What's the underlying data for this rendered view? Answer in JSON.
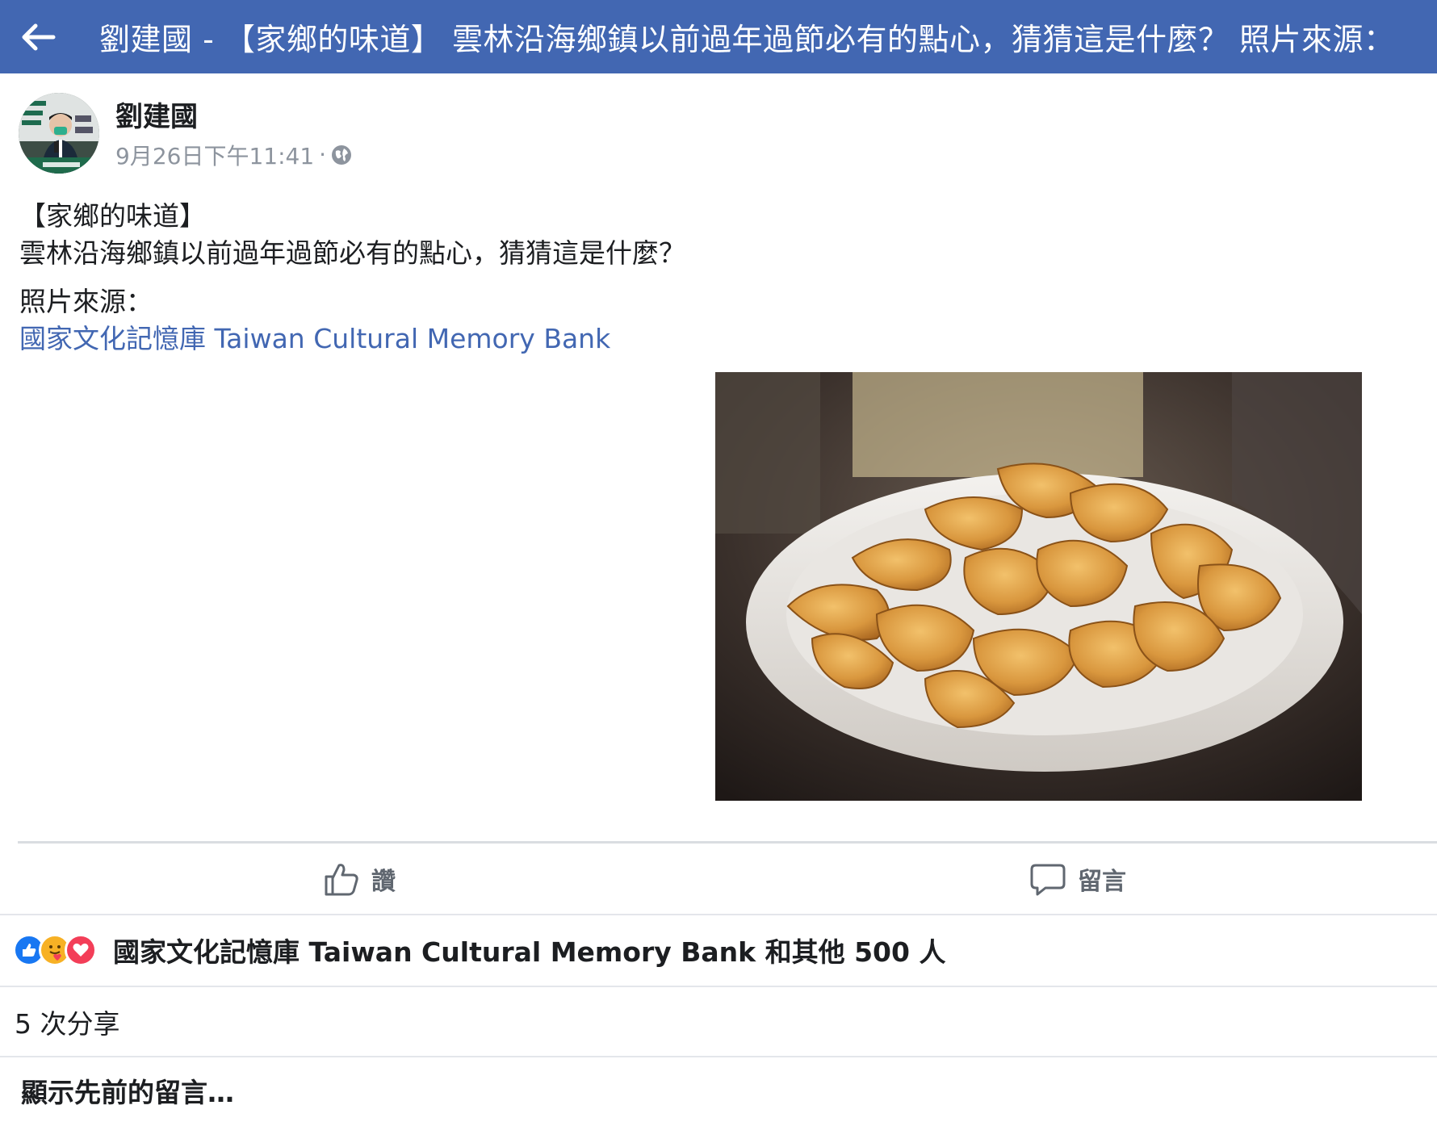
{
  "topbar": {
    "back_icon": "back-arrow-icon",
    "title": "劉建國 - 【家鄉的味道】 雲林沿海鄉鎮以前過年過節必有的點心，猜猜這是什麼？ 照片來源："
  },
  "post": {
    "author": "劉建國",
    "timestamp": "9月26日下午11:41",
    "separator": "·",
    "privacy_icon": "globe-icon",
    "lines": {
      "line1": "【家鄉的味道】",
      "line2": "雲林沿海鄉鎮以前過年過節必有的點心，猜猜這是什麼？",
      "line3": "照片來源：",
      "link": "國家文化記憶庫 Taiwan Cultural Memory Bank"
    },
    "photo_icon": "fried-dumplings-photo"
  },
  "actions": {
    "like_label": "讚",
    "comment_label": "留言",
    "like_icon": "thumbs-up-icon",
    "comment_icon": "comment-bubble-icon"
  },
  "reactions": {
    "icons": [
      "like-reaction-icon",
      "care-reaction-icon",
      "love-reaction-icon"
    ],
    "text": "國家文化記憶庫 Taiwan Cultural Memory Bank 和其他 500 人"
  },
  "shares": {
    "text": "5 次分享"
  },
  "comments": {
    "show_previous": "顯示先前的留言…"
  },
  "colors": {
    "brand": "#4267b2",
    "link": "#4267b2",
    "meta": "#8d949e",
    "like_blue": "#1877f2",
    "love_red": "#f33e58",
    "care_yellow": "#f7b125"
  }
}
